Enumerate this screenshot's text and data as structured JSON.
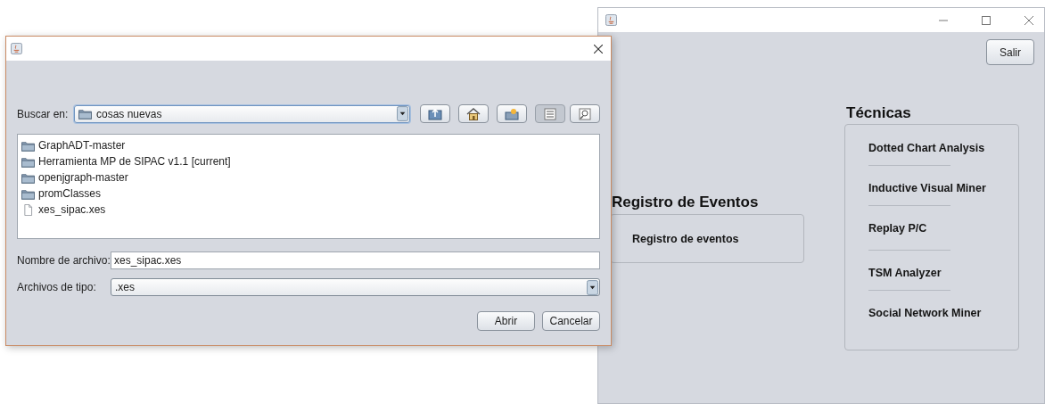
{
  "main_window": {
    "salir_button": "Salir",
    "eventos": {
      "title": "Registro de Eventos",
      "button": "Registro de eventos"
    },
    "tecnicas": {
      "title": "Técnicas",
      "items": [
        "Dotted Chart Analysis",
        "Inductive Visual Miner",
        "Replay P/C",
        "TSM Analyzer",
        "Social Network Miner"
      ]
    }
  },
  "dialog": {
    "look_in": {
      "label": "Buscar en:",
      "value": "cosas nuevas"
    },
    "toolbar": [
      {
        "kind": "up",
        "selected": false
      },
      {
        "kind": "home",
        "selected": false
      },
      {
        "kind": "new-folder",
        "selected": false
      },
      {
        "kind": "list",
        "selected": true
      },
      {
        "kind": "details",
        "selected": false
      }
    ],
    "files": [
      {
        "name": "GraphADT-master",
        "kind": "folder"
      },
      {
        "name": "Herramienta MP de SIPAC v1.1 [current]",
        "kind": "folder"
      },
      {
        "name": "openjgraph-master",
        "kind": "folder"
      },
      {
        "name": "promClasses",
        "kind": "folder"
      },
      {
        "name": "xes_sipac.xes",
        "kind": "file"
      }
    ],
    "file_name": {
      "label": "Nombre de archivo:",
      "value": "xes_sipac.xes"
    },
    "file_type": {
      "label": "Archivos de tipo:",
      "value": ".xes"
    },
    "buttons": [
      "Abrir",
      "Cancelar"
    ]
  }
}
